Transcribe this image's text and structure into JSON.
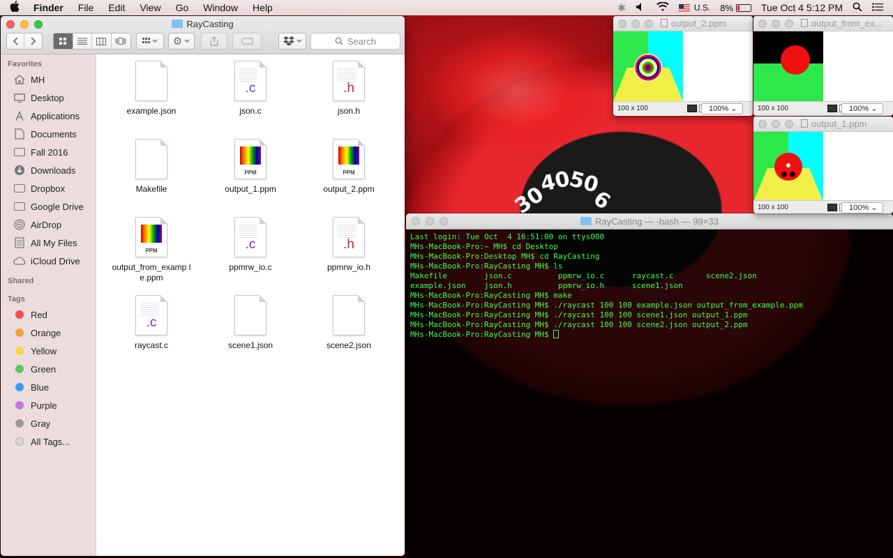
{
  "menubar": {
    "app": "Finder",
    "items": [
      "File",
      "Edit",
      "View",
      "Go",
      "Window",
      "Help"
    ],
    "locale": "U.S.",
    "battery": "8%",
    "clock": "Tue Oct 4  5:12 PM"
  },
  "finder": {
    "title": "RayCasting",
    "search_placeholder": "Search",
    "sidebar": {
      "favorites_header": "Favorites",
      "favorites": [
        "MH",
        "Desktop",
        "Applications",
        "Documents",
        "Fall 2016",
        "Downloads",
        "Dropbox",
        "Google Drive",
        "AirDrop",
        "All My Files",
        "iCloud Drive"
      ],
      "shared_header": "Shared",
      "tags_header": "Tags",
      "tags": [
        {
          "label": "Red",
          "color": "#f0504e"
        },
        {
          "label": "Orange",
          "color": "#f5a03a"
        },
        {
          "label": "Yellow",
          "color": "#f5d54a"
        },
        {
          "label": "Green",
          "color": "#5bc85a"
        },
        {
          "label": "Blue",
          "color": "#3a9cf0"
        },
        {
          "label": "Purple",
          "color": "#c47ad8"
        },
        {
          "label": "Gray",
          "color": "#9a9a9a"
        },
        {
          "label": "All Tags...",
          "color": "#d8d8d8"
        }
      ]
    },
    "files": [
      {
        "name": "example.json",
        "kind": "blank"
      },
      {
        "name": "json.c",
        "kind": "c",
        "ext": ".c"
      },
      {
        "name": "json.h",
        "kind": "h",
        "ext": ".h"
      },
      {
        "name": "Makefile",
        "kind": "blank"
      },
      {
        "name": "output_1.ppm",
        "kind": "ppm",
        "ext": "PPM"
      },
      {
        "name": "output_2.ppm",
        "kind": "ppm",
        "ext": "PPM"
      },
      {
        "name": "output_from_example.ppm",
        "kind": "ppm",
        "ext": "PPM",
        "display": "output_from_examp le.ppm"
      },
      {
        "name": "ppmrw_io.c",
        "kind": "c",
        "ext": ".c"
      },
      {
        "name": "ppmrw_io.h",
        "kind": "h",
        "ext": ".h"
      },
      {
        "name": "raycast.c",
        "kind": "c",
        "ext": ".c"
      },
      {
        "name": "scene1.json",
        "kind": "blank"
      },
      {
        "name": "scene2.json",
        "kind": "blank"
      }
    ]
  },
  "previews": [
    {
      "title": "output_2.ppm",
      "size": "100 x 100",
      "zoom": "100%"
    },
    {
      "title": "output_from_ex...",
      "size": "100 x 100",
      "zoom": "100%"
    },
    {
      "title": "output_1.ppm",
      "size": "100 x 100",
      "zoom": "100%"
    }
  ],
  "terminal": {
    "title": "RayCasting — -bash — 99×33",
    "lines": [
      "Last login: Tue Oct  4 16:51:00 on ttys000",
      "MHs-MacBook-Pro:~ MH$ cd Desktop",
      "MHs-MacBook-Pro:Desktop MH$ cd RayCasting",
      "MHs-MacBook-Pro:RayCasting MH$ ls",
      "Makefile        json.c          ppmrw_io.c      raycast.c       scene2.json",
      "example.json    json.h          ppmrw_io.h      scene1.json",
      "MHs-MacBook-Pro:RayCasting MH$ make",
      "MHs-MacBook-Pro:RayCasting MH$ ./raycast 100 100 example.json output_from_example.ppm",
      "MHs-MacBook-Pro:RayCasting MH$ ./raycast 100 100 scene1.json output_1.ppm",
      "MHs-MacBook-Pro:RayCasting MH$ ./raycast 100 100 scene2.json output_2.ppm",
      "MHs-MacBook-Pro:RayCasting MH$ "
    ]
  },
  "desktop": {
    "gauge_numbers": [
      "30",
      "40",
      "50",
      "6"
    ]
  }
}
